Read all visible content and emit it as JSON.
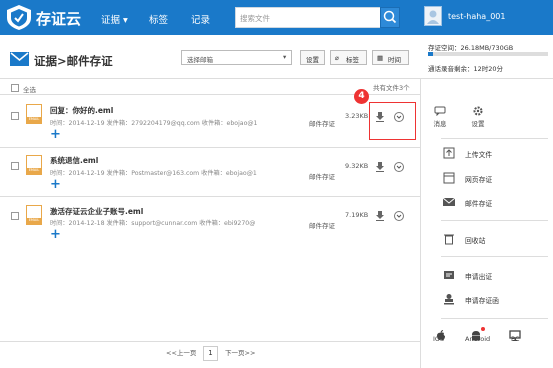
{
  "header": {
    "brand": "存证云",
    "nav": [
      "证据",
      "标签",
      "记录"
    ],
    "search_placeholder": "搜索文件",
    "username": "test-haha_001"
  },
  "toolbar": {
    "title": "证据>邮件存证",
    "select_value": "选择邮箱",
    "btn_settings": "设置",
    "btn_tags": "标签",
    "btn_time": "时间"
  },
  "storage": {
    "space": "存证空间：26.18MB/730GB",
    "expire": "通话录音剩余：12时20分",
    "used_fraction": 0.04
  },
  "list": {
    "select_all": "全选",
    "count": "共有文件3个",
    "items": [
      {
        "name": "回复：你好的.eml",
        "meta": "时间：2014-12-19  发件箱：2792204179@qq.com  收件箱：ebojao@1",
        "type": "邮件存证",
        "size": "3.23KB",
        "icon_label": "EMAIL"
      },
      {
        "name": "系统退信.eml",
        "meta": "时间：2014-12-19  发件箱：Postmaster@163.com  收件箱：ebojao@1",
        "type": "邮件存证",
        "size": "9.32KB",
        "icon_label": "EMAIL"
      },
      {
        "name": "激活存证云企业子账号.eml",
        "meta": "时间：2014-12-18  发件箱：support@cunnar.com  收件箱：ebi9270@",
        "type": "邮件存证",
        "size": "7.19KB",
        "icon_label": "EMAIL"
      }
    ]
  },
  "annotation": {
    "step": "4"
  },
  "side": {
    "msg": "消息",
    "settings": "设置",
    "menu": [
      "上传文件",
      "网页存证",
      "邮件存证",
      "回收站",
      "申请出证",
      "申请存证函"
    ],
    "platforms": [
      "IOS",
      "Android",
      "PC"
    ]
  },
  "pager": {
    "prev": "<<上一页",
    "page": "1",
    "next": "下一页>>"
  },
  "colors": {
    "primary": "#1a79c9",
    "highlight": "#e33333"
  }
}
